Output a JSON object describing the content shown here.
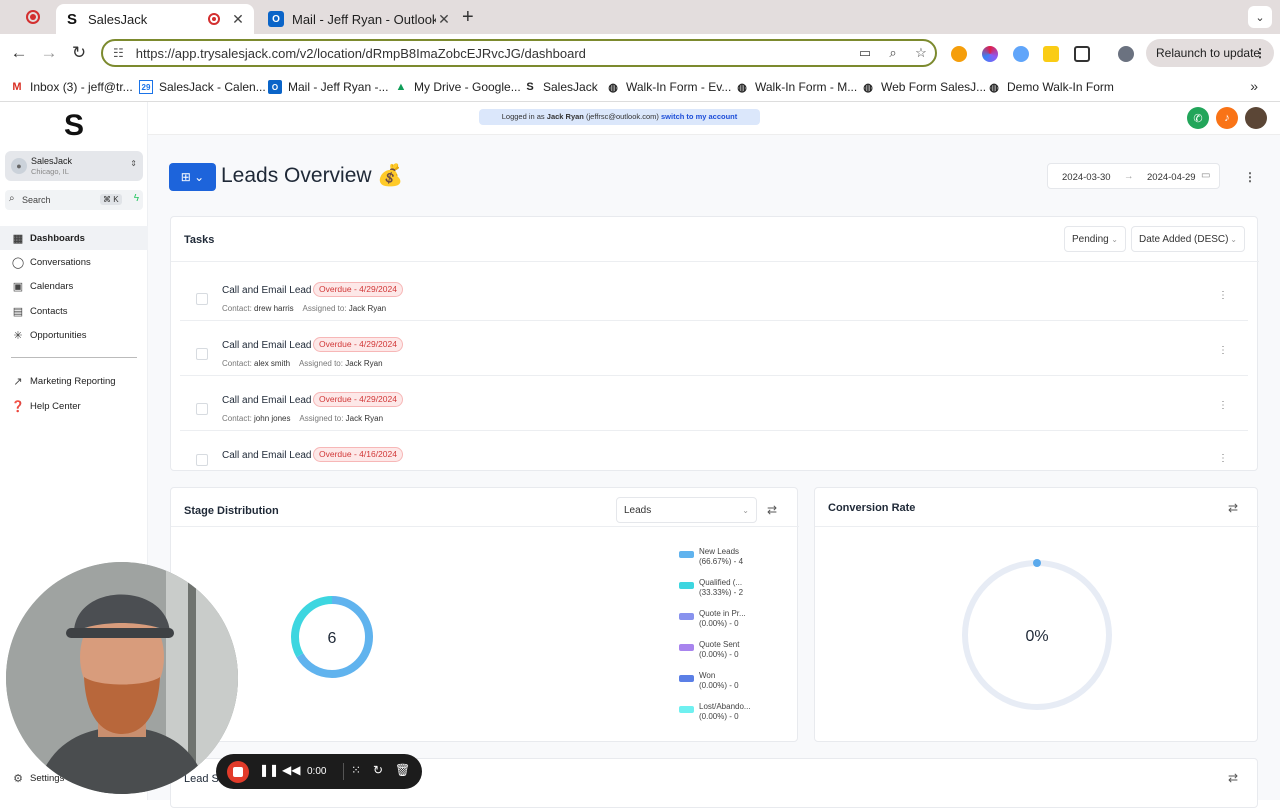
{
  "browser": {
    "tabs": [
      {
        "title": "SalesJack",
        "active": true
      },
      {
        "title": "Mail - Jeff Ryan - Outlook",
        "active": false
      }
    ],
    "url": "https://app.trysalesjack.com/v2/location/dRmpB8ImaZobcEJRvcJG/dashboard",
    "relaunch_label": "Relaunch to update",
    "bookmarks": [
      "Inbox (3) - jeff@tr...",
      "SalesJack - Calen...",
      "Mail - Jeff Ryan -...",
      "My Drive - Google...",
      "SalesJack",
      "Walk-In Form - Ev...",
      "Walk-In Form - M...",
      "Web Form SalesJ...",
      "Demo Walk-In Form"
    ]
  },
  "sidebar": {
    "account_name": "SalesJack",
    "account_location": "Chicago, IL",
    "search_label": "Search",
    "search_shortcut": "⌘ K",
    "items": [
      {
        "label": "Dashboards",
        "icon": "grid-icon"
      },
      {
        "label": "Conversations",
        "icon": "chat-icon"
      },
      {
        "label": "Calendars",
        "icon": "calendar-icon"
      },
      {
        "label": "Contacts",
        "icon": "contacts-icon"
      },
      {
        "label": "Opportunities",
        "icon": "opportunities-icon"
      }
    ],
    "secondary_items": [
      {
        "label": "Marketing Reporting",
        "icon": "trend-icon"
      },
      {
        "label": "Help Center",
        "icon": "help-icon"
      }
    ],
    "settings_label": "Settings"
  },
  "header": {
    "login_prefix": "Logged in as",
    "login_user": "Jack Ryan",
    "login_email": "(jeffrsc@outlook.com)",
    "switch_label": "switch to my account"
  },
  "page": {
    "title": "Leads Overview",
    "title_emoji": "💰",
    "date_start": "2024-03-30",
    "date_end": "2024-04-29"
  },
  "tasks": {
    "title": "Tasks",
    "status_filter": "Pending",
    "sort_filter": "Date Added (DESC)",
    "contact_label": "Contact:",
    "assigned_label": "Assigned to:",
    "rows": [
      {
        "name": "Call and Email Lead",
        "badge": "Overdue - 4/29/2024",
        "contact": "drew harris",
        "assigned": "Jack Ryan"
      },
      {
        "name": "Call and Email Lead",
        "badge": "Overdue - 4/29/2024",
        "contact": "alex smith",
        "assigned": "Jack Ryan"
      },
      {
        "name": "Call and Email Lead",
        "badge": "Overdue - 4/29/2024",
        "contact": "john jones",
        "assigned": "Jack Ryan"
      },
      {
        "name": "Call and Email Lead",
        "badge": "Overdue - 4/16/2024",
        "contact": "",
        "assigned": ""
      }
    ]
  },
  "stage_distribution": {
    "title": "Stage Distribution",
    "pipeline": "Leads",
    "total": "6",
    "legend": [
      {
        "line1": "New Leads",
        "line2": "(66.67%) - 4",
        "color": "#60b3ee",
        "value": 4
      },
      {
        "line1": "Qualified (...",
        "line2": "(33.33%) - 2",
        "color": "#3dd6e0",
        "value": 2
      },
      {
        "line1": "Quote in Pr...",
        "line2": "(0.00%) - 0",
        "color": "#8892ee",
        "value": 0
      },
      {
        "line1": "Quote Sent",
        "line2": "(0.00%) - 0",
        "color": "#a884ee",
        "value": 0
      },
      {
        "line1": "Won",
        "line2": "(0.00%) - 0",
        "color": "#5b7fe6",
        "value": 0
      },
      {
        "line1": "Lost/Abando...",
        "line2": "(0.00%) - 0",
        "color": "#6ff0f0",
        "value": 0
      }
    ]
  },
  "conversion_rate": {
    "title": "Conversion Rate",
    "value_text": "0%",
    "value": 0
  },
  "lead_card": {
    "title_partial": "Lead S"
  },
  "recorder": {
    "time": "0:00"
  }
}
